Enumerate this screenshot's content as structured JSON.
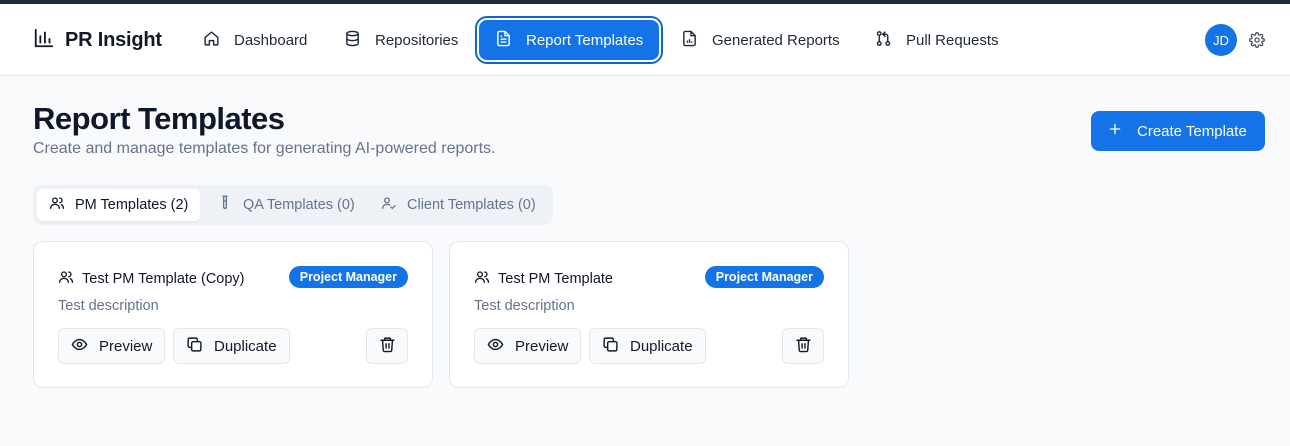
{
  "app": {
    "name": "PR Insight"
  },
  "nav": {
    "items": [
      {
        "label": "Dashboard",
        "icon": "home-icon"
      },
      {
        "label": "Repositories",
        "icon": "database-icon"
      },
      {
        "label": "Report Templates",
        "icon": "file-text-icon",
        "active": true
      },
      {
        "label": "Generated Reports",
        "icon": "file-chart-icon"
      },
      {
        "label": "Pull Requests",
        "icon": "git-pull-request-icon"
      }
    ]
  },
  "user": {
    "initials": "JD"
  },
  "page": {
    "title": "Report Templates",
    "subtitle": "Create and manage templates for generating AI-powered reports.",
    "create_button": "Create Template"
  },
  "tabs": [
    {
      "label": "PM Templates (2)",
      "icon": "users-icon",
      "active": true
    },
    {
      "label": "QA Templates (0)",
      "icon": "test-tube-icon"
    },
    {
      "label": "Client Templates (0)",
      "icon": "user-check-icon"
    }
  ],
  "templates": [
    {
      "title": "Test PM Template (Copy)",
      "badge": "Project Manager",
      "description": "Test description",
      "preview_label": "Preview",
      "duplicate_label": "Duplicate"
    },
    {
      "title": "Test PM Template",
      "badge": "Project Manager",
      "description": "Test description",
      "preview_label": "Preview",
      "duplicate_label": "Duplicate"
    }
  ],
  "colors": {
    "accent": "#1473e6",
    "muted_text": "#64748b",
    "background": "#f8fafc"
  }
}
